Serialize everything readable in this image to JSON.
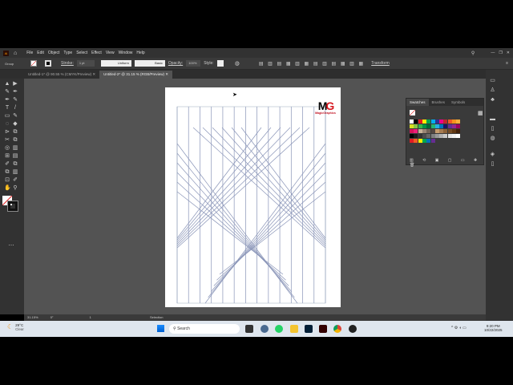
{
  "menubar": {
    "items": [
      "File",
      "Edit",
      "Object",
      "Type",
      "Select",
      "Effect",
      "View",
      "Window",
      "Help"
    ]
  },
  "control": {
    "selection": "Group",
    "stroke_label": "Stroke:",
    "stroke_weight": "1 pt",
    "profile": "Uniform",
    "brush": "Basic",
    "opacity_label": "Opacity:",
    "opacity": "100%",
    "style_label": "Style:",
    "transform": "Transform"
  },
  "tabs": [
    {
      "label": "Untitled-1* @ 90.55 % (CMYK/Preview)"
    },
    {
      "label": "Untitled-2* @ 31.15 % (RGB/Preview)"
    }
  ],
  "logo": {
    "text": "MagicGraphics",
    "mark": "MG"
  },
  "swatches_panel": {
    "tabs": [
      "Swatches",
      "Brushes",
      "Symbols"
    ]
  },
  "swatch_colors": [
    "#ffffff",
    "#000000",
    "#e21d24",
    "#ffed00",
    "#00a650",
    "#00aeef",
    "#2e3192",
    "#ec008c",
    "#c1272d",
    "#f15a24",
    "#f7931e",
    "#fbb03b",
    "#d9e021",
    "#8cc63f",
    "#39b54a",
    "#009245",
    "#006837",
    "#22b573",
    "#29abe2",
    "#0071bc",
    "#1b1464",
    "#662d91",
    "#93278f",
    "#9e005d",
    "#d4145a",
    "#ed1e79",
    "#c7b299",
    "#998675",
    "#736357",
    "#534741",
    "#c69c6d",
    "#a67c52",
    "#8c6239",
    "#754c24",
    "#603813",
    "#42210b",
    "#000000",
    "#1a1a1a",
    "#333333",
    "#4d4d4d",
    "#666666",
    "#808080",
    "#999999",
    "#b3b3b3",
    "#cccccc",
    "#e6e6e6",
    "#f2f2f2",
    "#ffffff",
    "#e21d24",
    "#f15a24",
    "#ffed00",
    "#00a650",
    "#0071bc",
    "#662d91"
  ],
  "status": {
    "zoom": "31.15%",
    "rotation": "0°",
    "page": "1",
    "tool": "Selection"
  },
  "taskbar": {
    "temp": "29°C",
    "weather": "Clear",
    "search": "Search",
    "time": "9:20 PM",
    "date": "10/22/2025"
  }
}
